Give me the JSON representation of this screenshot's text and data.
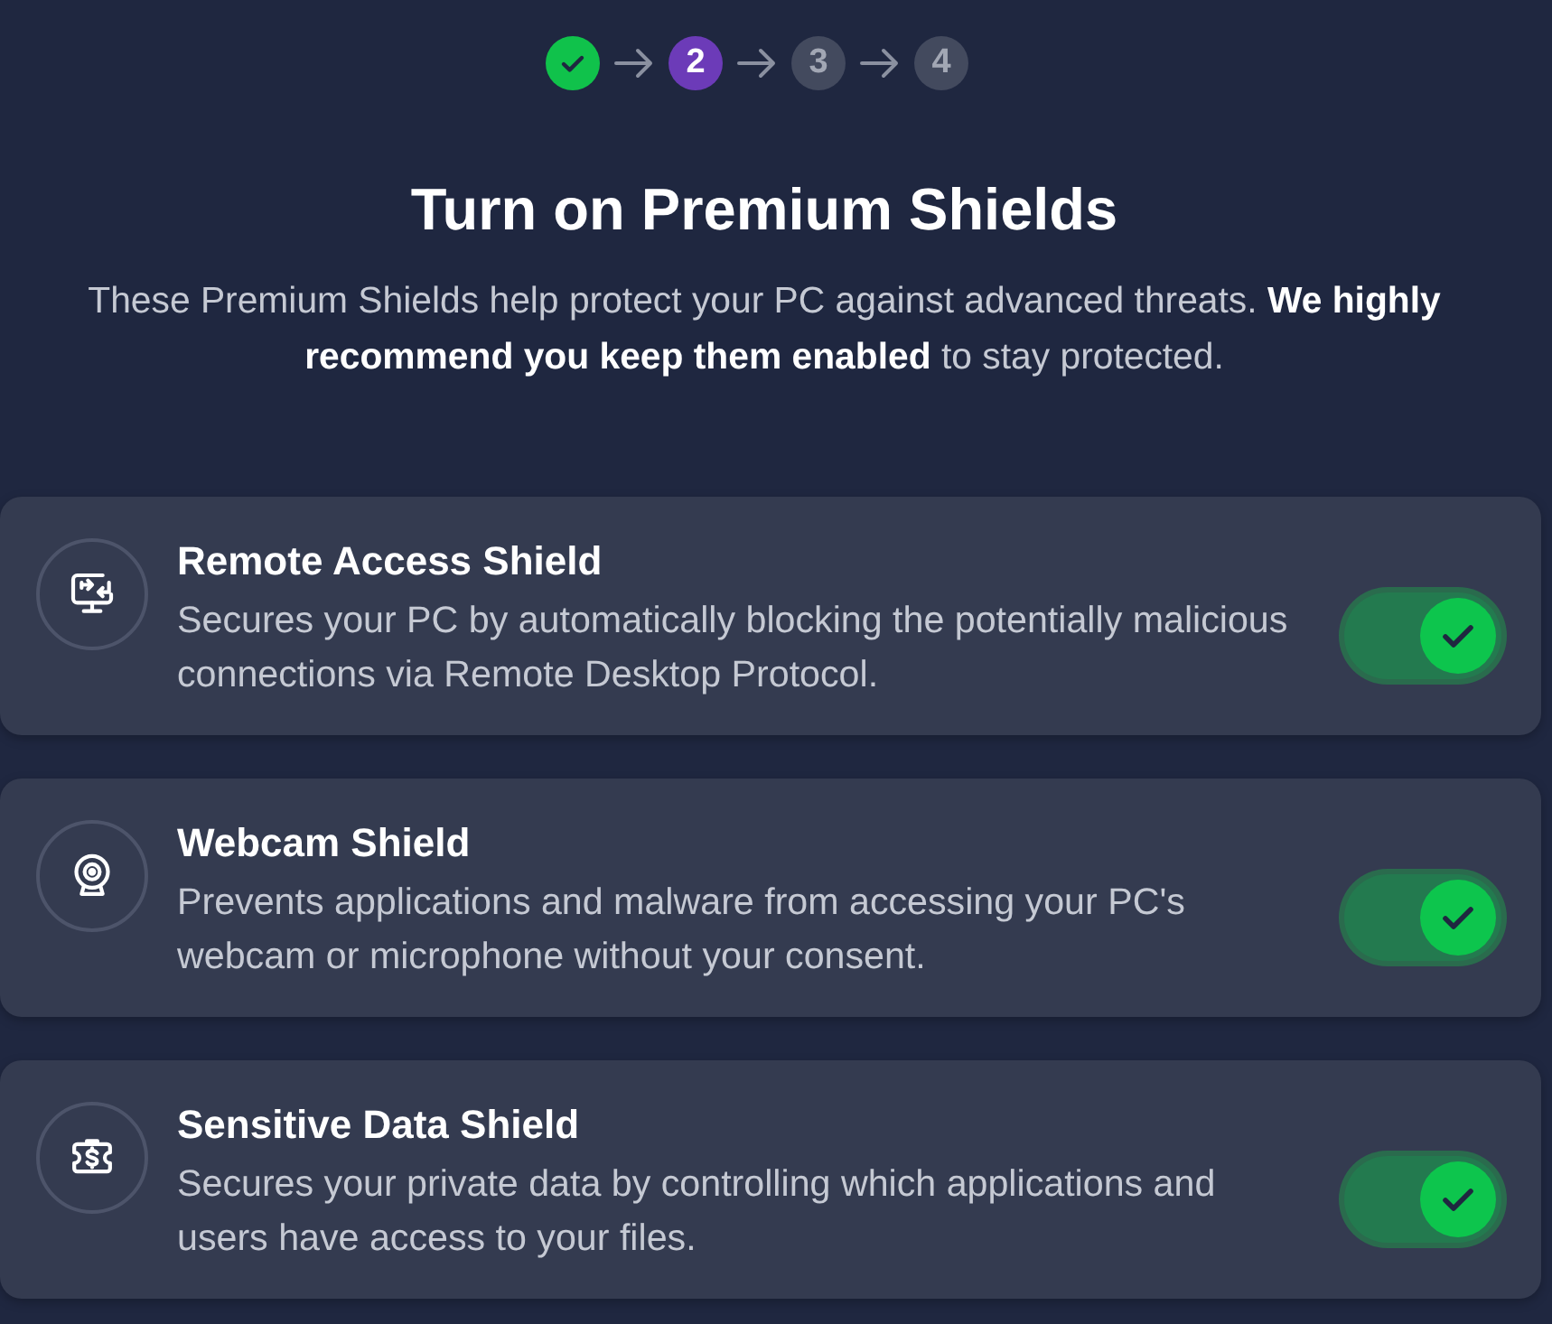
{
  "steps": [
    {
      "done": true,
      "selected": false
    },
    {
      "label": "2",
      "done": false,
      "selected": true
    },
    {
      "label": "3",
      "done": false,
      "selected": false
    },
    {
      "label": "4",
      "done": false,
      "selected": false
    }
  ],
  "heading": "Turn on Premium Shields",
  "description": "These Premium Shields help protect your PC against advanced threats. **We highly recommend you keep them enabled** to stay protected.",
  "shields": [
    {
      "kind": "remote",
      "title": "Remote Access Shield",
      "description": "Secures your PC by automatically blocking the potentially malicious connections via Remote Desktop Protocol.",
      "on": true
    },
    {
      "kind": "webcam",
      "title": "Webcam Shield",
      "description": "Prevents applications and malware from accessing your PC's webcam or microphone without your consent.",
      "on": true
    },
    {
      "kind": "data",
      "title": "Sensitive Data Shield",
      "description": "Secures your private data by controlling which applications and users have access to your files.",
      "on": true
    }
  ]
}
